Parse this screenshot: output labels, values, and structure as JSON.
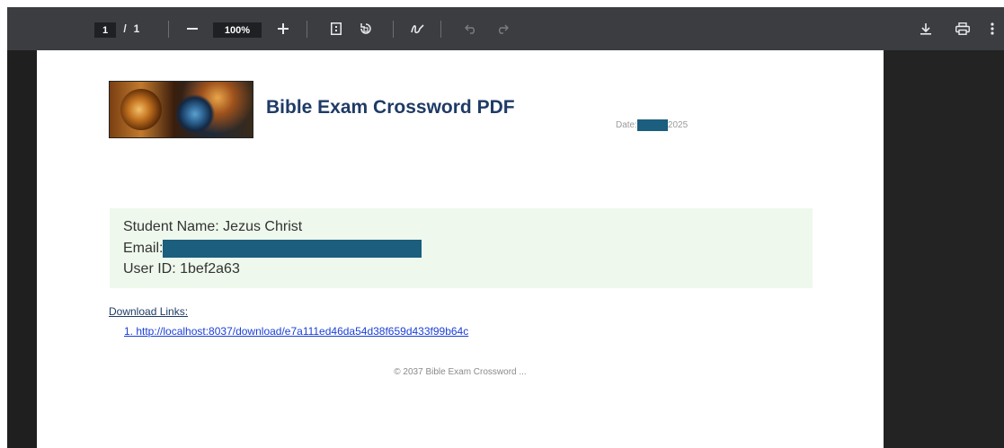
{
  "toolbar": {
    "page_current": "1",
    "page_separator": "/",
    "page_total": "1",
    "zoom_out_icon": "minus-icon",
    "zoom_level": "100%",
    "zoom_in_icon": "plus-icon",
    "fit_page_icon": "fit-page-icon",
    "rotate_icon": "rotate-icon",
    "draw_icon": "draw-icon",
    "undo_icon": "undo-icon",
    "redo_icon": "redo-icon",
    "download_icon": "download-icon",
    "print_icon": "print-icon",
    "more_icon": "more-vert-icon"
  },
  "document": {
    "title": "Bible Exam Crossword PDF",
    "date_label": "Date:",
    "date_year": "2025",
    "student_name_line": "Student Name: Jezus Christ",
    "email_label": "Email: ",
    "user_id_line": "User ID: 1bef2a63",
    "downloads_heading": "Download Links:",
    "download_link": "1. http://localhost:8037/download/e7a111ed46da54d38f659d433f99b64c",
    "footer": "© 2037 Bible Exam Crossword ..."
  },
  "colors": {
    "toolbar_bg": "#3b3d40",
    "viewer_bg": "#333639",
    "title_color": "#1f3b66",
    "info_box_bg": "#eef8ec",
    "redaction": "#1b5e7e",
    "link_color": "#1a3fd6"
  }
}
